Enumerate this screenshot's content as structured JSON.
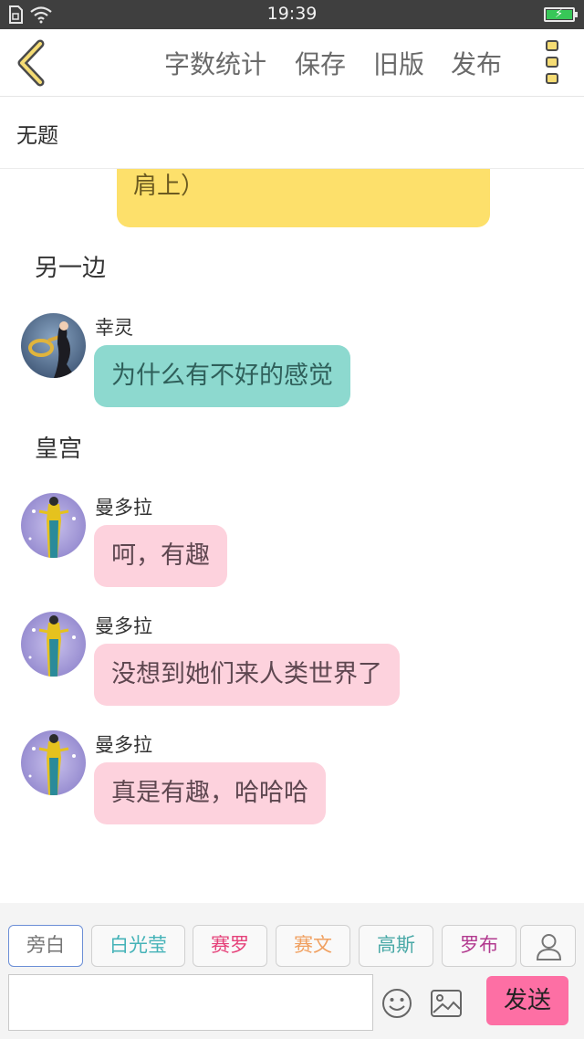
{
  "status_bar": {
    "time": "19:39",
    "icons": [
      "sim-icon",
      "wifi-icon",
      "battery-charging-icon"
    ]
  },
  "header": {
    "back_icon": "chevron-left-icon",
    "word_count_label": "字数统计",
    "save_label": "保存",
    "old_version_label": "旧版",
    "publish_label": "发布",
    "more_icon": "more-vertical-icon"
  },
  "title_bar": {
    "title": "无题"
  },
  "story": {
    "narration_partial": "就看不惯她们（坐在谱座真的\n肩上）",
    "scene_1": "另一边",
    "message_1": {
      "name": "幸灵",
      "text": "为什么有不好的感觉",
      "color": "#8dd9cf"
    },
    "scene_2": "皇宫",
    "message_2": {
      "name": "曼多拉",
      "text": "呵，有趣",
      "color": "#fdd2dd"
    },
    "message_3": {
      "name": "曼多拉",
      "text": "没想到她们来人类世界了",
      "color": "#fdd2dd"
    },
    "message_4": {
      "name": "曼多拉",
      "text": "真是有趣，哈哈哈",
      "color": "#fdd2dd"
    }
  },
  "characters": [
    {
      "label": "旁白",
      "color": "#777777",
      "selected": true
    },
    {
      "label": "白光莹",
      "color": "#45b3b8",
      "selected": false
    },
    {
      "label": "赛罗",
      "color": "#e5427a",
      "selected": false
    },
    {
      "label": "赛文",
      "color": "#f0a060",
      "selected": false
    },
    {
      "label": "高斯",
      "color": "#4aa9a7",
      "selected": false
    },
    {
      "label": "罗布",
      "color": "#b23a8f",
      "selected": false
    }
  ],
  "composer": {
    "input_value": "",
    "input_placeholder": "",
    "add_character_icon": "user-icon",
    "emoji_icon": "smiley-icon",
    "image_icon": "image-icon",
    "send_label": "发送",
    "send_color": "#fd6fa4"
  }
}
